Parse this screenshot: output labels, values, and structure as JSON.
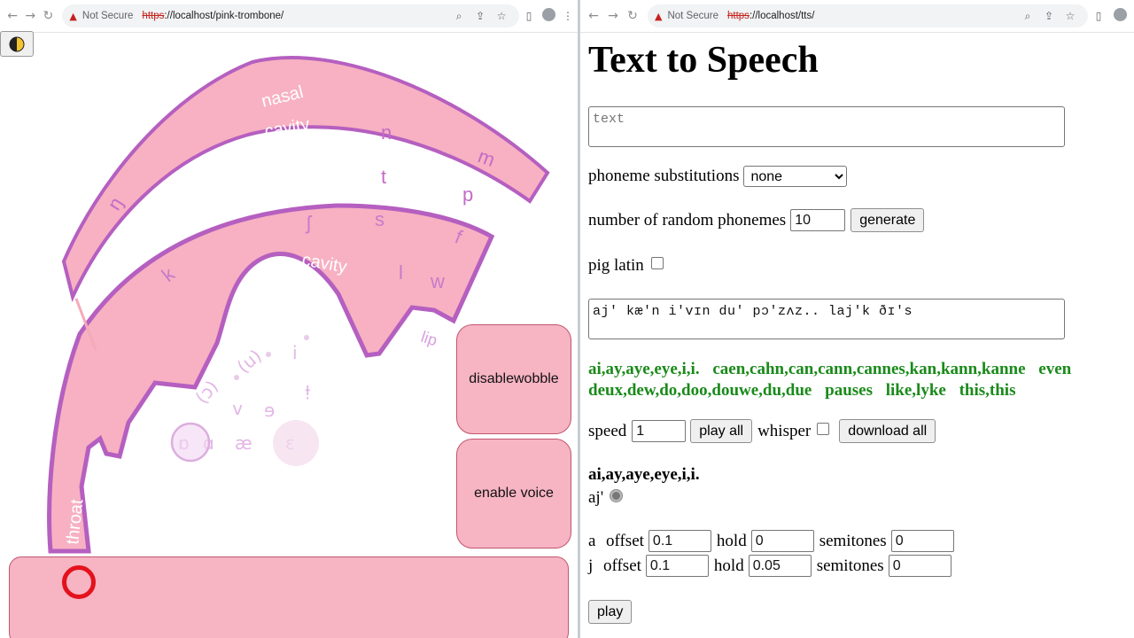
{
  "browser_left": {
    "security": "Not Secure",
    "url_scheme": "https",
    "url_rest": "://localhost/pink-trombone/"
  },
  "browser_right": {
    "security": "Not Secure",
    "url_scheme": "https",
    "url_rest": "://localhost/tts/"
  },
  "pink_trombone": {
    "tract_labels": {
      "nasal": "nasal",
      "cavity_top": "cavity",
      "oral_cavity": "cavity",
      "throat": "throat",
      "lip": "lip"
    },
    "consonants": [
      "n",
      "m",
      "t",
      "p",
      "ŋ",
      "ʃ",
      "s",
      "f",
      "k",
      "l",
      "w"
    ],
    "vowels": [
      "(ɔ)",
      "(u)",
      "i",
      "ʌ",
      "ɘ",
      "ɨ",
      "ɑ",
      "æ",
      "ɛ",
      "ɒ"
    ],
    "buttons": {
      "wobble": "disablewobble",
      "voice": "enable voice"
    }
  },
  "tts": {
    "title": "Text to Speech",
    "text_placeholder": "text",
    "phoneme_subs_label": "phoneme substitutions",
    "phoneme_subs_value": "none",
    "random_label": "number of random phonemes",
    "random_value": "10",
    "generate_label": "generate",
    "pig_latin_label": "pig latin",
    "ipa_value": "aj' kæ'n i'vɪn du' pɔ'zʌz.. laj'k ðɪ's",
    "words": [
      "ai,ay,aye,eye,i,i.",
      "caen,cahn,can,cann,cannes,kan,kann,kanne",
      "even",
      "deux,dew,do,doo,douwe,du,due",
      "pauses",
      "like,lyke",
      "this,this"
    ],
    "speed_label": "speed",
    "speed_value": "1",
    "play_all_label": "play all",
    "whisper_label": "whisper",
    "download_all_label": "download all",
    "section_heading": "ai,ay,aye,eye,i,i.",
    "section_ipa": "aj'",
    "phonemes": [
      {
        "symbol": "a",
        "offset": "0.1",
        "hold": "0",
        "semitones": "0"
      },
      {
        "symbol": "j",
        "offset": "0.1",
        "hold": "0.05",
        "semitones": "0"
      }
    ],
    "offset_label": "offset",
    "hold_label": "hold",
    "semitones_label": "semitones",
    "play_label": "play"
  },
  "colors": {
    "tract_fill": "#f7b1c2",
    "tract_stroke": "#b55fc0",
    "text_green": "#1a8a1a",
    "pitch_ring": "#e3121c"
  }
}
